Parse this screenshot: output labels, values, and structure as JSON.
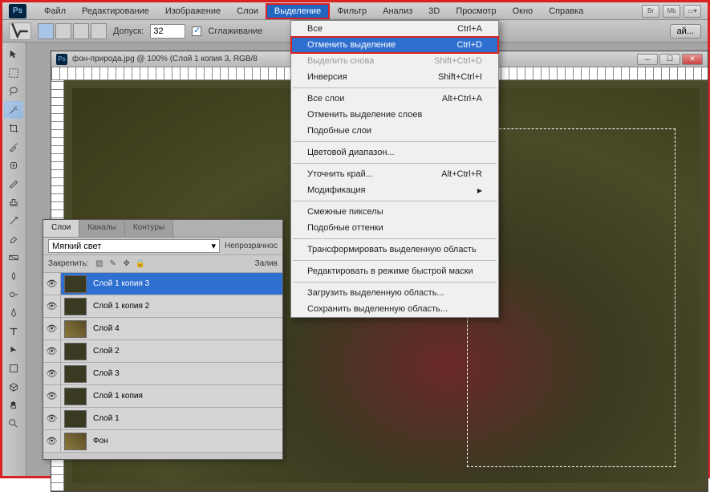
{
  "menubar": {
    "items": [
      "Файл",
      "Редактирование",
      "Изображение",
      "Слои",
      "Выделение",
      "Фильтр",
      "Анализ",
      "3D",
      "Просмотр",
      "Окно",
      "Справка"
    ],
    "active_index": 4,
    "right_buttons": [
      "Br",
      "Mb"
    ]
  },
  "optbar": {
    "tolerance_label": "Допуск:",
    "tolerance_value": "32",
    "antialias_label": "Сглаживание",
    "refine_button": "ай..."
  },
  "doc": {
    "title": "фон-природа.jpg @ 100% (Слой 1 копия 3, RGB/8"
  },
  "dropdown": {
    "items": [
      {
        "label": "Все",
        "shortcut": "Ctrl+A",
        "type": "item"
      },
      {
        "label": "Отменить выделение",
        "shortcut": "Ctrl+D",
        "type": "highlighted"
      },
      {
        "label": "Выделить снова",
        "shortcut": "Shift+Ctrl+D",
        "type": "disabled"
      },
      {
        "label": "Инверсия",
        "shortcut": "Shift+Ctrl+I",
        "type": "item"
      },
      {
        "type": "sep"
      },
      {
        "label": "Все слои",
        "shortcut": "Alt+Ctrl+A",
        "type": "item"
      },
      {
        "label": "Отменить выделение слоев",
        "shortcut": "",
        "type": "item"
      },
      {
        "label": "Подобные слои",
        "shortcut": "",
        "type": "item"
      },
      {
        "type": "sep"
      },
      {
        "label": "Цветовой диапазон...",
        "shortcut": "",
        "type": "item"
      },
      {
        "type": "sep"
      },
      {
        "label": "Уточнить край...",
        "shortcut": "Alt+Ctrl+R",
        "type": "item"
      },
      {
        "label": "Модификация",
        "shortcut": "",
        "type": "submenu"
      },
      {
        "type": "sep"
      },
      {
        "label": "Смежные пикселы",
        "shortcut": "",
        "type": "item"
      },
      {
        "label": "Подобные оттенки",
        "shortcut": "",
        "type": "item"
      },
      {
        "type": "sep"
      },
      {
        "label": "Трансформировать выделенную область",
        "shortcut": "",
        "type": "item"
      },
      {
        "type": "sep"
      },
      {
        "label": "Редактировать в режиме быстрой маски",
        "shortcut": "",
        "type": "item"
      },
      {
        "type": "sep"
      },
      {
        "label": "Загрузить выделенную область...",
        "shortcut": "",
        "type": "item"
      },
      {
        "label": "Сохранить выделенную область...",
        "shortcut": "",
        "type": "item"
      }
    ]
  },
  "panel": {
    "tabs": [
      "Слои",
      "Каналы",
      "Контуры"
    ],
    "active_tab": 0,
    "blend_mode": "Мягкий свет",
    "opacity_label": "Непрозрачнос",
    "lock_label": "Закрепить:",
    "fill_label": "Залив",
    "layers": [
      {
        "name": "Слой 1 копия 3",
        "selected": true,
        "thumb": "dark"
      },
      {
        "name": "Слой 1 копия 2",
        "selected": false,
        "thumb": "dark"
      },
      {
        "name": "Слой 4",
        "selected": false,
        "thumb": "img"
      },
      {
        "name": "Слой 2",
        "selected": false,
        "thumb": "dark"
      },
      {
        "name": "Слой 3",
        "selected": false,
        "thumb": "dark"
      },
      {
        "name": "Слой 1 копия",
        "selected": false,
        "thumb": "dark"
      },
      {
        "name": "Слой 1",
        "selected": false,
        "thumb": "dark"
      },
      {
        "name": "Фон",
        "selected": false,
        "thumb": "img"
      }
    ]
  }
}
